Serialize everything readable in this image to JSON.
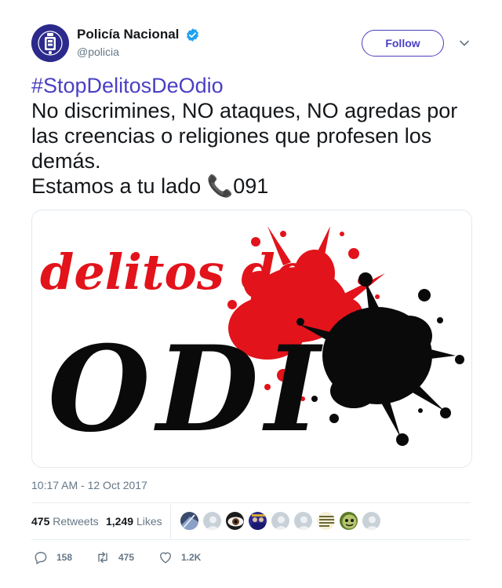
{
  "tweet": {
    "display_name": "Policía Nacional",
    "handle": "@policia",
    "follow_label": "Follow",
    "hashtag": "#StopDelitosDeOdio",
    "body_line1": "No discrimines, NO ataques, NO agredas por las creencias o religiones que profesen los demás.",
    "body_line2_text": "Estamos a tu lado ",
    "phone_glyph": "📞",
    "body_line2_number": "091",
    "timestamp": "10:17 AM - 12 Oct 2017"
  },
  "media": {
    "title_top": "delitos de",
    "title_bottom": "ODI"
  },
  "stats": {
    "retweets_count": "475",
    "retweets_label": "Retweets",
    "likes_count": "1,249",
    "likes_label": "Likes"
  },
  "actions": {
    "reply_count": "158",
    "retweet_count": "475",
    "like_count": "1.2K"
  },
  "colors": {
    "accent": "#4a3fc4",
    "verified": "#1da1f2",
    "muted": "#657786",
    "blood": "#e2131b"
  }
}
